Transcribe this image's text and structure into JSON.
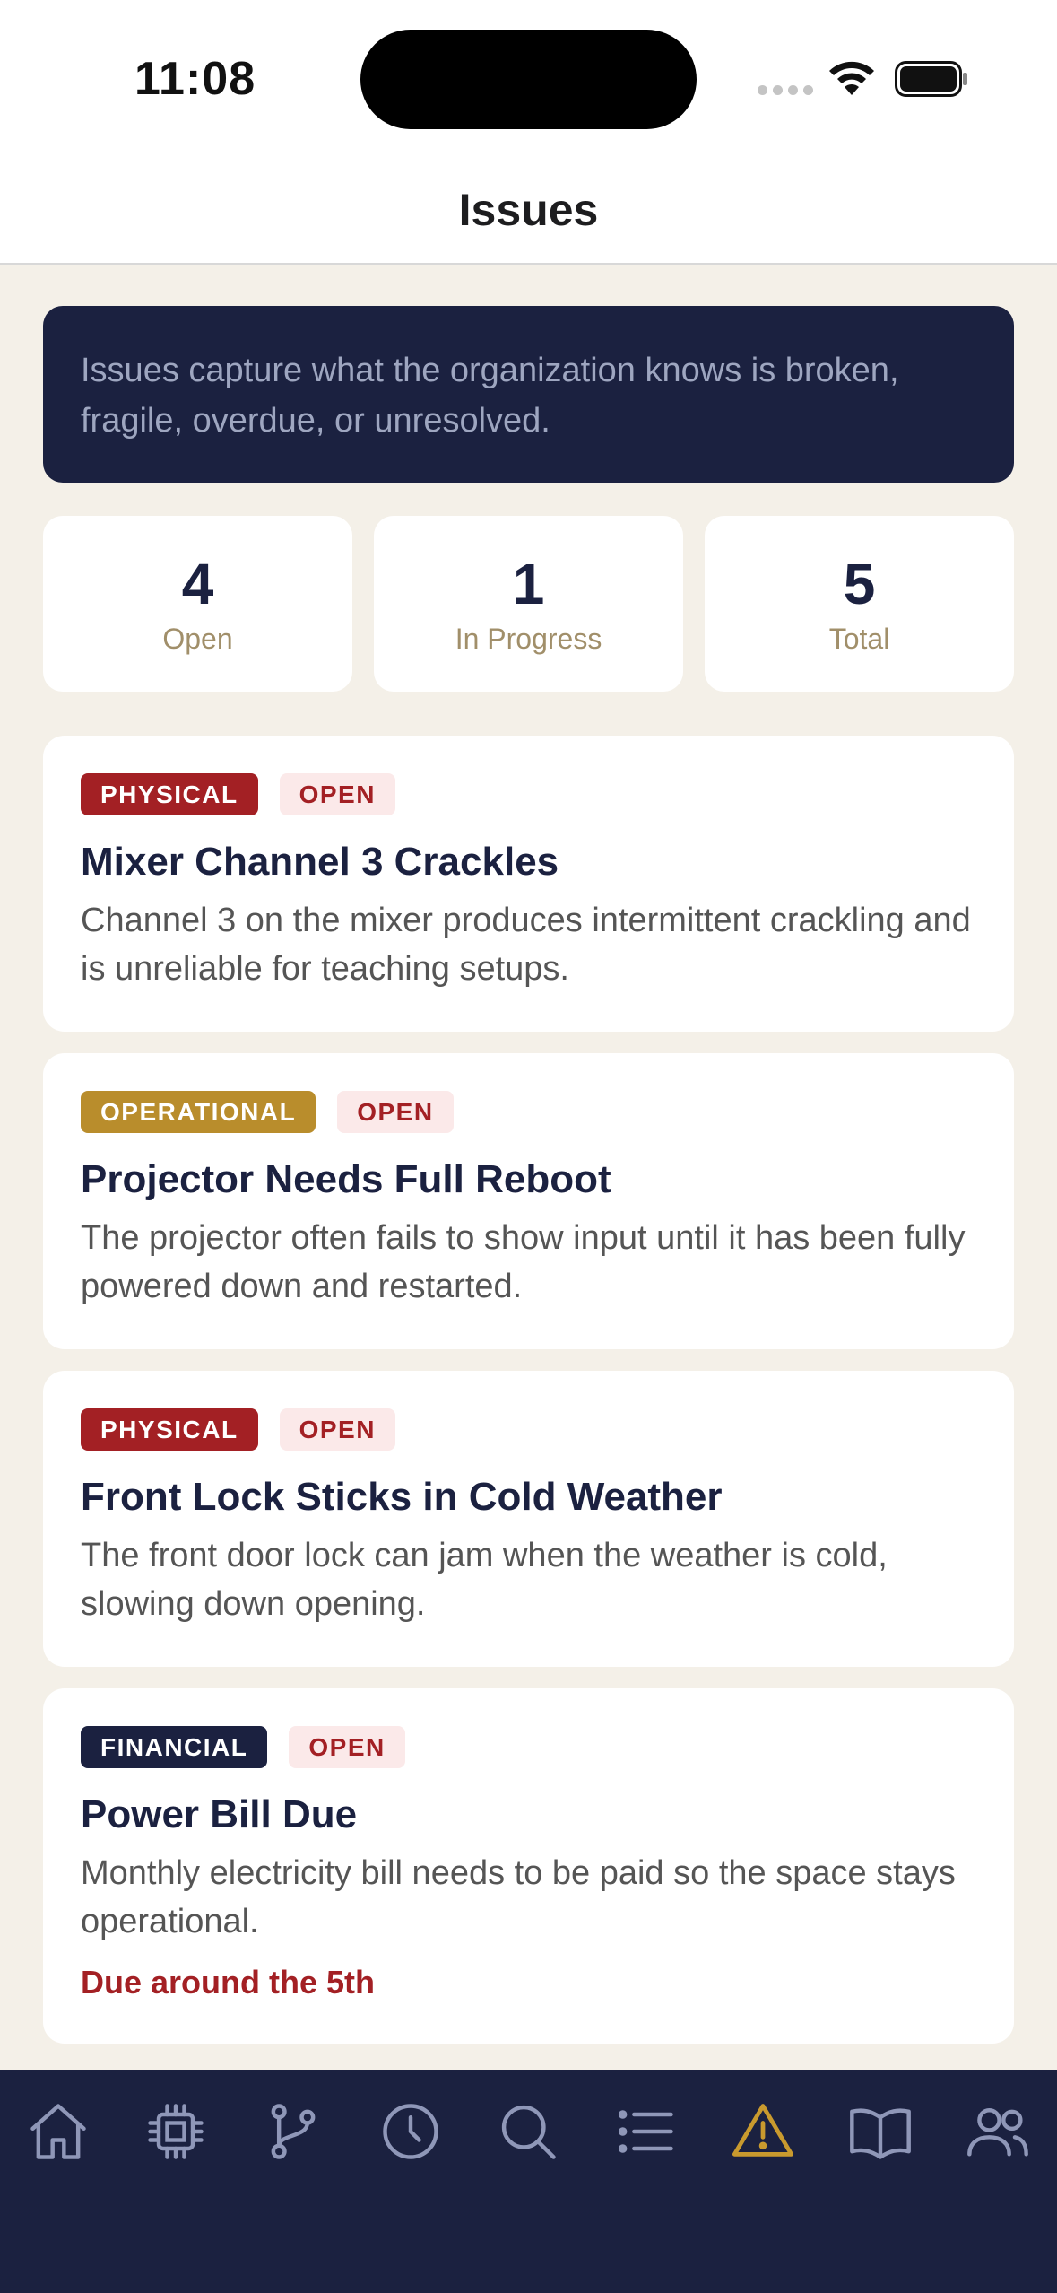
{
  "status": {
    "time": "11:08"
  },
  "header": {
    "title": "Issues"
  },
  "banner": {
    "text": "Issues capture what the organization knows is broken, fragile, overdue, or unresolved."
  },
  "stats": [
    {
      "value": "4",
      "label": "Open"
    },
    {
      "value": "1",
      "label": "In Progress"
    },
    {
      "value": "5",
      "label": "Total"
    }
  ],
  "issues": [
    {
      "category": "PHYSICAL",
      "status": "OPEN",
      "title": "Mixer Channel 3 Crackles",
      "description": "Channel 3 on the mixer produces intermittent crackling and is unreliable for teaching setups."
    },
    {
      "category": "OPERATIONAL",
      "status": "OPEN",
      "title": "Projector Needs Full Reboot",
      "description": "The projector often fails to show input until it has been fully powered down and restarted."
    },
    {
      "category": "PHYSICAL",
      "status": "OPEN",
      "title": "Front Lock Sticks in Cold Weather",
      "description": "The front door lock can jam when the weather is cold, slowing down opening."
    },
    {
      "category": "FINANCIAL",
      "status": "OPEN",
      "title": "Power Bill Due",
      "description": "Monthly electricity bill needs to be paid so the space stays operational.",
      "due": "Due around the 5th"
    }
  ],
  "tabbar": {
    "icons": [
      "home-icon",
      "chip-icon",
      "branch-icon",
      "clock-icon",
      "search-icon",
      "list-icon",
      "warning-icon",
      "book-icon",
      "people-icon"
    ],
    "active": "warning-icon",
    "active_color": "#c99a2e",
    "inactive_color": "#8f97b8"
  },
  "colors": {
    "navy": "#1b2140",
    "physical": "#a32024",
    "operational": "#b98d2c",
    "background": "#f4f0e8"
  }
}
